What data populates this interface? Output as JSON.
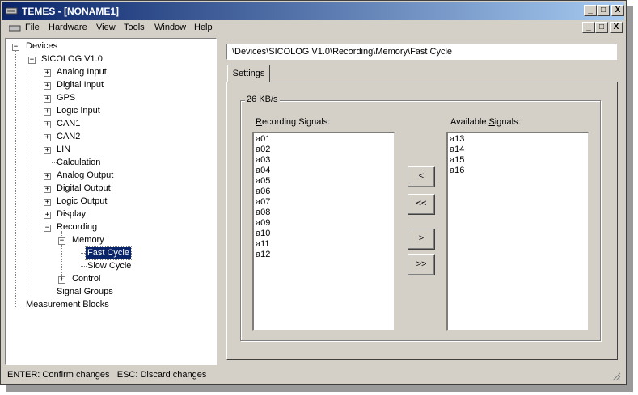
{
  "window": {
    "title": "TEMES - [NONAME1]",
    "controls": [
      "_",
      "□",
      "X"
    ]
  },
  "menu": [
    "File",
    "Hardware",
    "View",
    "Tools",
    "Window",
    "Help"
  ],
  "tree": [
    {
      "label": "Devices",
      "expander": "−"
    },
    {
      "label": "SICOLOG V1.0",
      "expander": "−"
    },
    {
      "label": "Analog Input",
      "expander": "+"
    },
    {
      "label": "Digital Input",
      "expander": "+"
    },
    {
      "label": "GPS",
      "expander": "+"
    },
    {
      "label": "Logic Input",
      "expander": "+"
    },
    {
      "label": "CAN1",
      "expander": "+"
    },
    {
      "label": "CAN2",
      "expander": "+"
    },
    {
      "label": "LIN",
      "expander": "+"
    },
    {
      "label": "Calculation",
      "expander": ""
    },
    {
      "label": "Analog Output",
      "expander": "+"
    },
    {
      "label": "Digital Output",
      "expander": "+"
    },
    {
      "label": "Logic Output",
      "expander": "+"
    },
    {
      "label": "Display",
      "expander": "+"
    },
    {
      "label": "Recording",
      "expander": "−"
    },
    {
      "label": "Memory",
      "expander": "−"
    },
    {
      "label": "Fast Cycle",
      "expander": "",
      "selected": true
    },
    {
      "label": "Slow Cycle",
      "expander": ""
    },
    {
      "label": "Control",
      "expander": "+"
    },
    {
      "label": "Signal Groups",
      "expander": ""
    },
    {
      "label": "Measurement Blocks",
      "expander": ""
    }
  ],
  "path": "\\Devices\\SICOLOG V1.0\\Recording\\Memory\\Fast Cycle",
  "tabs": [
    {
      "label": "Settings"
    }
  ],
  "group": {
    "label": "26 KB/s"
  },
  "recording": {
    "label_prefix": "R",
    "label_rest": "ecording Signals:",
    "items": [
      "a01",
      "a02",
      "a03",
      "a04",
      "a05",
      "a06",
      "a07",
      "a08",
      "a09",
      "a10",
      "a11",
      "a12"
    ]
  },
  "available": {
    "label_prefix": "Available ",
    "label_ul": "S",
    "label_rest": "ignals:",
    "items": [
      "a13",
      "a14",
      "a15",
      "a16"
    ]
  },
  "buttons": {
    "move_left": "<",
    "move_all_left": "<<",
    "move_right": ">",
    "move_all_right": ">>"
  },
  "status": "ENTER: Confirm changes   ESC: Discard changes",
  "colors": {
    "title_start": "#0a246a",
    "title_end": "#a6caf0",
    "face": "#d4d0c8",
    "selection": "#0a246a"
  }
}
